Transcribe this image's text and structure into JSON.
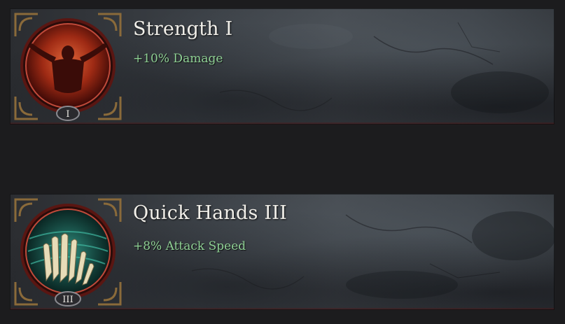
{
  "perks": [
    {
      "title": "Strength I",
      "effect": "+10% Damage",
      "rank_numeral": "I",
      "icon": "strength-figure-icon"
    },
    {
      "title": "Quick Hands III",
      "effect": "+8% Attack Speed",
      "rank_numeral": "III",
      "icon": "quick-hands-icon"
    }
  ],
  "colors": {
    "background": "#1c1c1e",
    "title_text": "#f1efe9",
    "effect_text": "#8fd094",
    "frame_red": "#7a1a14",
    "corner_gold": "#8a6a3a"
  }
}
